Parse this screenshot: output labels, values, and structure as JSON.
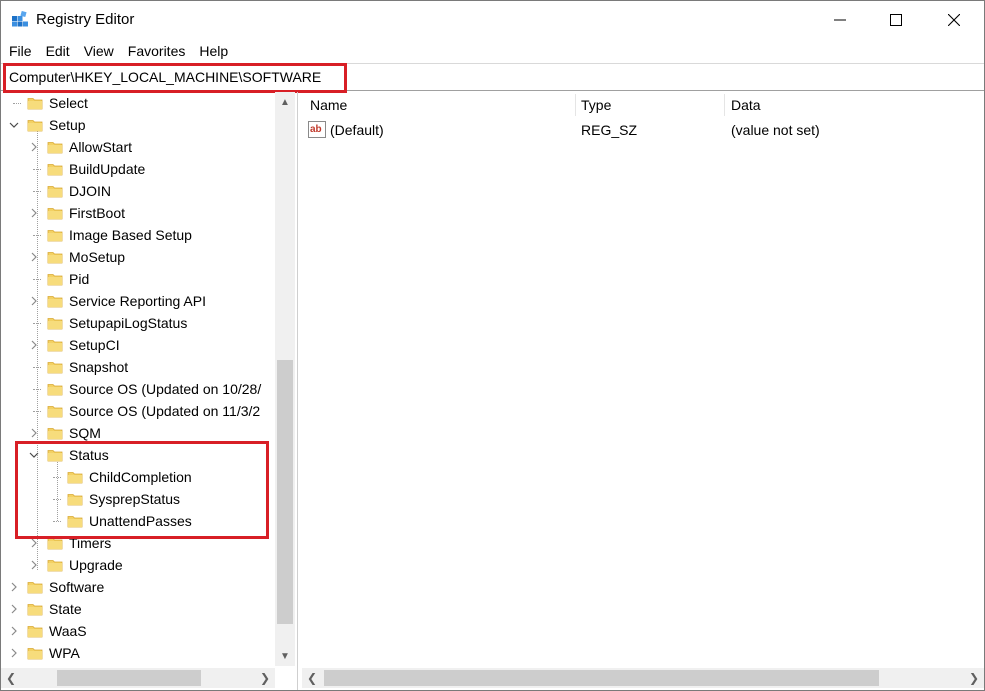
{
  "window": {
    "title": "Registry Editor",
    "app_icon": "registry-editor-icon",
    "controls": [
      "minimize-icon",
      "maximize-icon",
      "close-icon"
    ]
  },
  "menu": [
    "File",
    "Edit",
    "View",
    "Favorites",
    "Help"
  ],
  "address": {
    "value": "Computer\\HKEY_LOCAL_MACHINE\\SOFTWARE"
  },
  "tree": {
    "items": [
      {
        "label": "Select",
        "expander": "none"
      },
      {
        "label": "Setup",
        "expander": "expanded"
      },
      {
        "label": "AllowStart",
        "expander": "collapsed"
      },
      {
        "label": "BuildUpdate",
        "expander": "none"
      },
      {
        "label": "DJOIN",
        "expander": "none"
      },
      {
        "label": "FirstBoot",
        "expander": "collapsed"
      },
      {
        "label": "Image Based Setup",
        "expander": "none"
      },
      {
        "label": "MoSetup",
        "expander": "collapsed"
      },
      {
        "label": "Pid",
        "expander": "none"
      },
      {
        "label": "Service Reporting API",
        "expander": "collapsed"
      },
      {
        "label": "SetupapiLogStatus",
        "expander": "none"
      },
      {
        "label": "SetupCI",
        "expander": "collapsed"
      },
      {
        "label": "Snapshot",
        "expander": "none"
      },
      {
        "label": "Source OS (Updated on 10/28/",
        "expander": "none"
      },
      {
        "label": "Source OS (Updated on 11/3/2",
        "expander": "none"
      },
      {
        "label": "SQM",
        "expander": "collapsed"
      },
      {
        "label": "Status",
        "expander": "expanded"
      },
      {
        "label": "ChildCompletion",
        "expander": "none"
      },
      {
        "label": "SysprepStatus",
        "expander": "none"
      },
      {
        "label": "UnattendPasses",
        "expander": "none"
      },
      {
        "label": "Timers",
        "expander": "collapsed"
      },
      {
        "label": "Upgrade",
        "expander": "collapsed"
      },
      {
        "label": "Software",
        "expander": "collapsed"
      },
      {
        "label": "State",
        "expander": "collapsed"
      },
      {
        "label": "WaaS",
        "expander": "collapsed"
      },
      {
        "label": "WPA",
        "expander": "collapsed"
      }
    ]
  },
  "list": {
    "columns": [
      "Name",
      "Type",
      "Data"
    ],
    "rows": [
      {
        "name": "(Default)",
        "type": "REG_SZ",
        "data": "(value not set)",
        "icon": "string-value-icon"
      }
    ]
  },
  "colors": {
    "highlight_border": "#d81f26",
    "folder_fill": "#f3d163",
    "folder_edge": "#d9a833",
    "scrollbar_thumb": "#cdcdcd"
  }
}
